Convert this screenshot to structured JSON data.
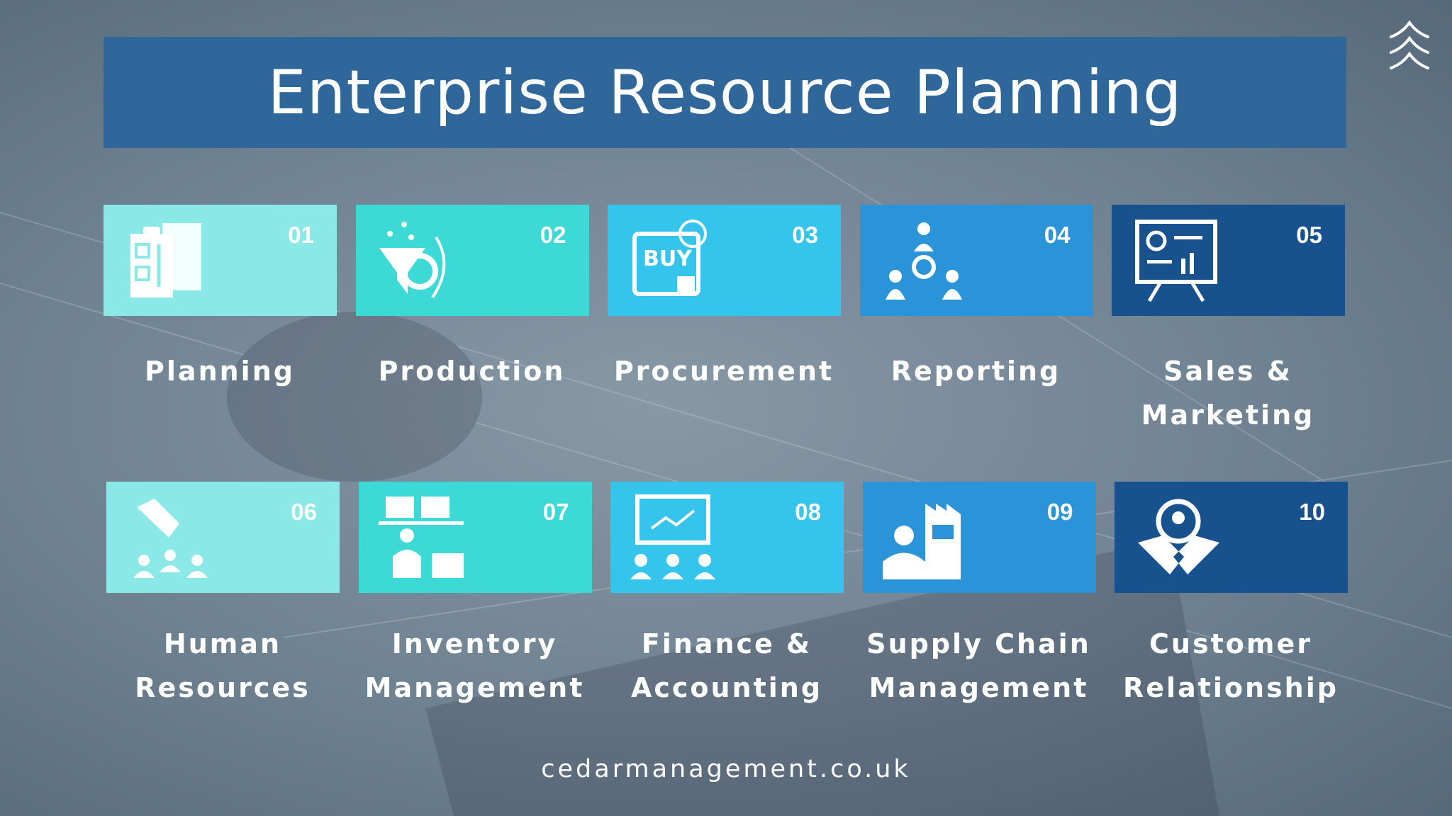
{
  "title": "Enterprise Resource Planning",
  "footer": "cedarmanagement.co.uk",
  "colors": {
    "title_bar": "#2f679a",
    "tile_1": "#8ae9e6",
    "tile_2": "#3dd9d6",
    "tile_3": "#35c4ec",
    "tile_4": "#2b93d8",
    "tile_5": "#17518e"
  },
  "modules": [
    {
      "num": "01",
      "label": "Planning",
      "icon": "clipboard-document-icon"
    },
    {
      "num": "02",
      "label": "Production",
      "icon": "funnel-gear-icon"
    },
    {
      "num": "03",
      "label": "Procurement",
      "icon": "buy-shop-icon"
    },
    {
      "num": "04",
      "label": "Reporting",
      "icon": "team-gear-icon"
    },
    {
      "num": "05",
      "label": "Sales & Marketing",
      "icon": "presentation-board-icon"
    },
    {
      "num": "06",
      "label": "Human Resources",
      "icon": "hand-picking-people-icon"
    },
    {
      "num": "07",
      "label": "Inventory Management",
      "icon": "worker-boxes-icon"
    },
    {
      "num": "08",
      "label": "Finance & Accounting",
      "icon": "chart-board-audience-icon"
    },
    {
      "num": "09",
      "label": "Supply Chain Management",
      "icon": "worker-factory-icon"
    },
    {
      "num": "10",
      "label": "Customer Relationship",
      "icon": "handshake-people-icon"
    }
  ]
}
